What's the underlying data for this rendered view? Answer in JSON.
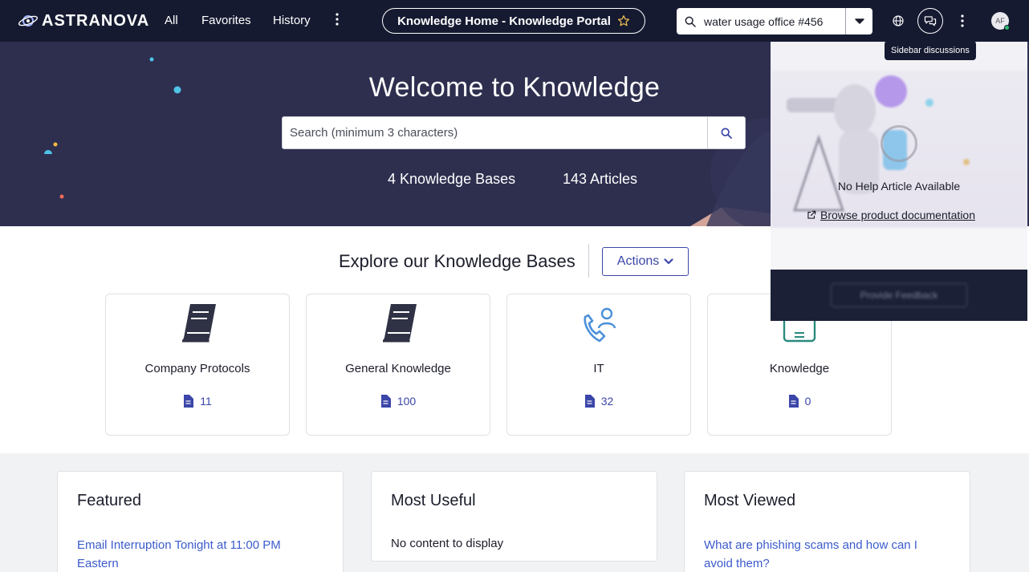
{
  "brand": {
    "name": "ASTRANOVA"
  },
  "nav": {
    "all": "All",
    "favorites": "Favorites",
    "history": "History",
    "title": "Knowledge Home - Knowledge Portal",
    "search_value": "water usage office #456",
    "avatar_initials": "AF",
    "tooltip": "Sidebar discussions"
  },
  "hero": {
    "title": "Welcome to Knowledge",
    "search_placeholder": "Search (minimum 3 characters)",
    "kb_count": "4 Knowledge Bases",
    "article_count": "143 Articles"
  },
  "explore": {
    "title": "Explore our Knowledge Bases",
    "actions_label": "Actions",
    "cards": [
      {
        "name": "Company Protocols",
        "count": "11",
        "icon": "book-icon"
      },
      {
        "name": "General Knowledge",
        "count": "100",
        "icon": "book-icon"
      },
      {
        "name": "IT",
        "count": "32",
        "icon": "phone-person-icon"
      },
      {
        "name": "Knowledge",
        "count": "0",
        "icon": "clipboard-icon"
      }
    ]
  },
  "panels": {
    "featured": {
      "title": "Featured",
      "link": "Email Interruption Tonight at 11:00 PM Eastern"
    },
    "most_useful": {
      "title": "Most Useful",
      "empty": "No content to display"
    },
    "most_viewed": {
      "title": "Most Viewed",
      "link": "What are phishing scams and how can I avoid them?"
    }
  },
  "help_sidebar": {
    "message": "No Help Article Available",
    "link": "Browse product documentation",
    "feedback": "Provide Feedback"
  },
  "colors": {
    "nav_bg": "#161a31",
    "hero_bg": "#2e2f4f",
    "accent": "#3b46a8",
    "link": "#3b5bcc"
  }
}
